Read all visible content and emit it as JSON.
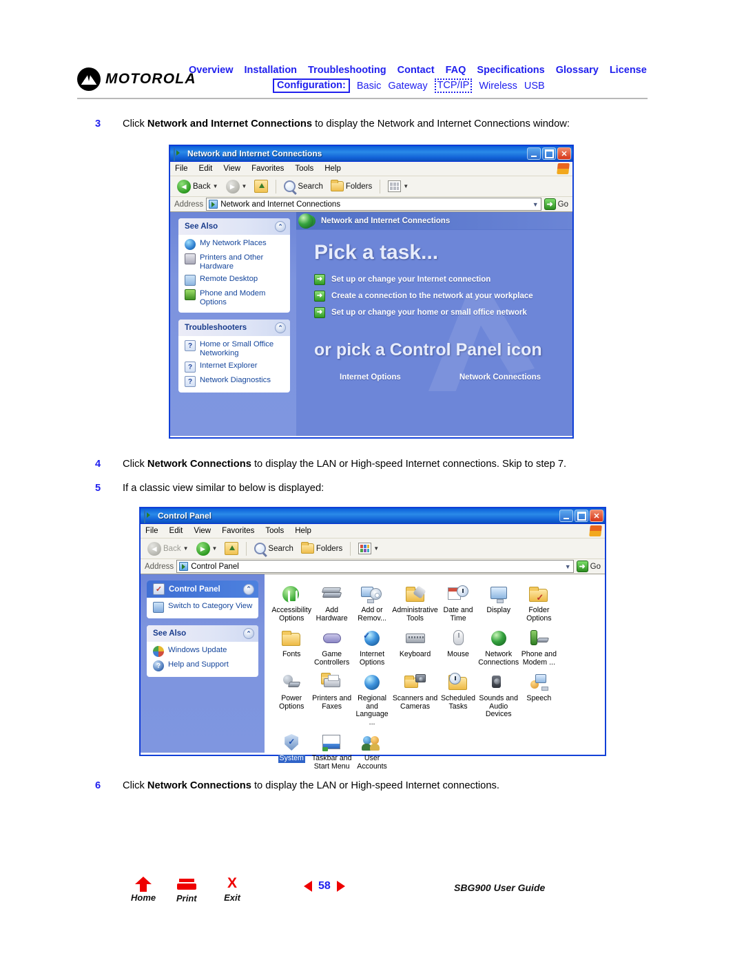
{
  "header": {
    "brand": "MOTOROLA",
    "brand_icon": "motorola-batwing-logo",
    "nav_top": [
      {
        "label": "Overview"
      },
      {
        "label": "Installation"
      },
      {
        "label": "Troubleshooting"
      },
      {
        "label": "Contact"
      },
      {
        "label": "FAQ"
      },
      {
        "label": "Specifications"
      },
      {
        "label": "Glossary"
      },
      {
        "label": "License"
      }
    ],
    "nav_sub_label": "Configuration:",
    "nav_sub": [
      {
        "label": "Basic",
        "selected": false
      },
      {
        "label": "Gateway",
        "selected": false
      },
      {
        "label": "TCP/IP",
        "selected": true
      },
      {
        "label": "Wireless",
        "selected": false
      },
      {
        "label": "USB",
        "selected": false
      }
    ],
    "link_color": "#2020ee"
  },
  "steps": {
    "s3": {
      "num": "3",
      "pre": "Click ",
      "bold": "Network and Internet Connections",
      "post": " to display the Network and Internet Connections window:"
    },
    "s4": {
      "num": "4",
      "pre": "Click ",
      "bold": "Network Connections",
      "post": " to display the LAN or High-speed Internet connections. Skip to step 7."
    },
    "s5": {
      "num": "5",
      "pre": "If a classic view similar to below is displayed:",
      "bold": "",
      "post": ""
    },
    "s6": {
      "num": "6",
      "pre": "Click ",
      "bold": "Network Connections",
      "post": " to display the LAN or High-speed Internet connections."
    }
  },
  "window1": {
    "title": "Network and Internet Connections",
    "title_icon": "control-panel-folder-icon",
    "buttons": {
      "minimize": "_",
      "maximize": "□",
      "close": "✕"
    },
    "menus": [
      "File",
      "Edit",
      "View",
      "Favorites",
      "Tools",
      "Help"
    ],
    "toolbar": {
      "back": "Back",
      "forward": "",
      "up": "",
      "search": "Search",
      "folders": "Folders",
      "views": ""
    },
    "address": {
      "label": "Address",
      "value": "Network and Internet Connections",
      "go": "Go"
    },
    "sidebar": [
      {
        "title": "See Also",
        "collapse_icon": "chevron-up-icon",
        "items": [
          {
            "label": "My Network Places",
            "icon": "network-places-icon"
          },
          {
            "label": "Printers and Other Hardware",
            "icon": "printer-icon"
          },
          {
            "label": "Remote Desktop",
            "icon": "remote-desktop-icon"
          },
          {
            "label": "Phone and Modem Options",
            "icon": "phone-modem-icon"
          }
        ]
      },
      {
        "title": "Troubleshooters",
        "collapse_icon": "chevron-up-icon",
        "items": [
          {
            "label": "Home or Small Office Networking",
            "icon": "question-icon"
          },
          {
            "label": "Internet Explorer",
            "icon": "question-icon"
          },
          {
            "label": "Network Diagnostics",
            "icon": "question-icon"
          }
        ]
      }
    ],
    "banner": {
      "title": "Network and Internet Connections",
      "icon": "network-globe-icon"
    },
    "heading1": "Pick a task...",
    "tasks": [
      {
        "label": "Set up or change your Internet connection",
        "icon": "green-arrow-icon"
      },
      {
        "label": "Create a connection to the network at your workplace",
        "icon": "green-arrow-icon"
      },
      {
        "label": "Set up or change your home or small office network",
        "icon": "green-arrow-icon"
      }
    ],
    "heading2": "or pick a Control Panel icon",
    "cp_icons": [
      {
        "label": "Internet Options",
        "icon": "internet-options-icon"
      },
      {
        "label": "Network Connections",
        "icon": "network-connections-icon"
      }
    ]
  },
  "window2": {
    "title": "Control Panel",
    "title_icon": "control-panel-folder-icon",
    "menus": [
      "File",
      "Edit",
      "View",
      "Favorites",
      "Tools",
      "Help"
    ],
    "toolbar": {
      "back": "Back",
      "forward": "",
      "up": "",
      "search": "Search",
      "folders": "Folders",
      "views": ""
    },
    "address": {
      "label": "Address",
      "value": "Control Panel",
      "go": "Go"
    },
    "sidebar": [
      {
        "title": "Control Panel",
        "selected": true,
        "collapse_icon": "chevron-up-icon",
        "items": [
          {
            "label": "Switch to Category View",
            "icon": "switch-view-icon"
          }
        ]
      },
      {
        "title": "See Also",
        "selected": false,
        "collapse_icon": "chevron-up-icon",
        "items": [
          {
            "label": "Windows Update",
            "icon": "windows-update-icon"
          },
          {
            "label": "Help and Support",
            "icon": "help-support-icon"
          }
        ]
      }
    ],
    "icons": [
      {
        "label": "Accessibility Options",
        "icon": "accessibility-icon",
        "selected": false
      },
      {
        "label": "Add Hardware",
        "icon": "add-hardware-icon",
        "selected": false
      },
      {
        "label": "Add or Remov...",
        "icon": "add-remove-programs-icon",
        "selected": false
      },
      {
        "label": "Administrative Tools",
        "icon": "administrative-tools-icon",
        "selected": false
      },
      {
        "label": "Date and Time",
        "icon": "date-time-icon",
        "selected": false
      },
      {
        "label": "Display",
        "icon": "display-icon",
        "selected": false
      },
      {
        "label": "Folder Options",
        "icon": "folder-options-icon",
        "selected": false
      },
      {
        "label": "Fonts",
        "icon": "fonts-icon",
        "selected": false
      },
      {
        "label": "Game Controllers",
        "icon": "game-controllers-icon",
        "selected": false
      },
      {
        "label": "Internet Options",
        "icon": "internet-options-icon",
        "selected": false
      },
      {
        "label": "Keyboard",
        "icon": "keyboard-icon",
        "selected": false
      },
      {
        "label": "Mouse",
        "icon": "mouse-icon",
        "selected": false
      },
      {
        "label": "Network Connections",
        "icon": "network-connections-icon",
        "selected": false
      },
      {
        "label": "Phone and Modem ...",
        "icon": "phone-modem-icon",
        "selected": false
      },
      {
        "label": "Power Options",
        "icon": "power-options-icon",
        "selected": false
      },
      {
        "label": "Printers and Faxes",
        "icon": "printers-faxes-icon",
        "selected": false
      },
      {
        "label": "Regional and Language ...",
        "icon": "regional-language-icon",
        "selected": false
      },
      {
        "label": "Scanners and Cameras",
        "icon": "scanners-cameras-icon",
        "selected": false
      },
      {
        "label": "Scheduled Tasks",
        "icon": "scheduled-tasks-icon",
        "selected": false
      },
      {
        "label": "Sounds and Audio Devices",
        "icon": "sounds-audio-icon",
        "selected": false
      },
      {
        "label": "Speech",
        "icon": "speech-icon",
        "selected": false
      },
      {
        "label": "System",
        "icon": "system-icon",
        "selected": true
      },
      {
        "label": "Taskbar and Start Menu",
        "icon": "taskbar-start-menu-icon",
        "selected": false
      },
      {
        "label": "User Accounts",
        "icon": "user-accounts-icon",
        "selected": false
      }
    ]
  },
  "footer": {
    "home": {
      "label": "Home",
      "icon": "home-icon"
    },
    "print": {
      "label": "Print",
      "icon": "printer-icon"
    },
    "exit": {
      "label": "Exit",
      "icon": "close-x-icon"
    },
    "prev_icon": "triangle-left-icon",
    "page_number": "58",
    "next_icon": "triangle-right-icon",
    "guide_name": "SBG900 User Guide",
    "accent_red": "#ee0000",
    "accent_blue": "#2020ee"
  }
}
